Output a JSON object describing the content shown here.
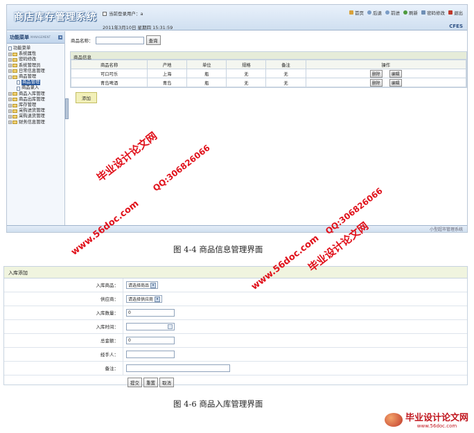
{
  "app": {
    "title": "商店库存管理系统",
    "current_user": "当前登录用户：a",
    "datetime": "2011年3月10日 星期四 15:31:59",
    "brand": "CFES",
    "status_text": "小型超市管理系统",
    "toolbar": [
      "首页",
      "后退",
      "前进",
      "刷新",
      "密码修改",
      "退出"
    ]
  },
  "sidebar": {
    "title": "功能菜单",
    "subtitle": "MANAGEMENT",
    "root": "功能菜单",
    "items": [
      "系统属性",
      "密码修改",
      "系统管理员",
      "日常信息管理",
      "商品管理",
      "商品管理",
      "商品录入",
      "商品入库管理",
      "商品出库管理",
      "库存管理",
      "采购进货管理",
      "采购退货管理",
      "财务信息管理"
    ]
  },
  "product_page": {
    "search_label": "商品名称：",
    "search_button": "查询",
    "panel_title": "商品信息",
    "columns": [
      "商品名称",
      "产地",
      "单位",
      "规格",
      "备注",
      "操作"
    ],
    "rows": [
      {
        "name": "可口可乐",
        "origin": "上海",
        "unit": "瓶",
        "spec": "无",
        "note": "无"
      },
      {
        "name": "青岛啤酒",
        "origin": "青岛",
        "unit": "瓶",
        "spec": "无",
        "note": "无"
      }
    ],
    "delete_label": "删除",
    "edit_label": "编辑",
    "add_button": "添加"
  },
  "captions": {
    "fig1": "图 4-4  商品信息管理界面",
    "fig2": "图 4-6  商品入库管理界面"
  },
  "stockin_form": {
    "title": "入库添加",
    "fields": {
      "product_label": "入库商品：",
      "product_value": "请选择商品",
      "supplier_label": "供应商：",
      "supplier_value": "请选择供应商",
      "qty_label": "入库数量：",
      "qty_value": "0",
      "time_label": "入库时间：",
      "total_label": "总金额：",
      "total_value": "0",
      "handler_label": "经手人：",
      "note_label": "备注："
    },
    "buttons": {
      "submit": "提交",
      "reset": "重置",
      "cancel": "取消"
    }
  },
  "watermarks": {
    "site_name": "毕业设计论文网",
    "url": "www.56doc.com",
    "qq": "QQ:306826066",
    "footer_url": "www.56doc.com"
  },
  "colors": {
    "accent": "#2a5a9e",
    "watermark": "#e0101a",
    "panel_bg": "#e6ecd9"
  }
}
